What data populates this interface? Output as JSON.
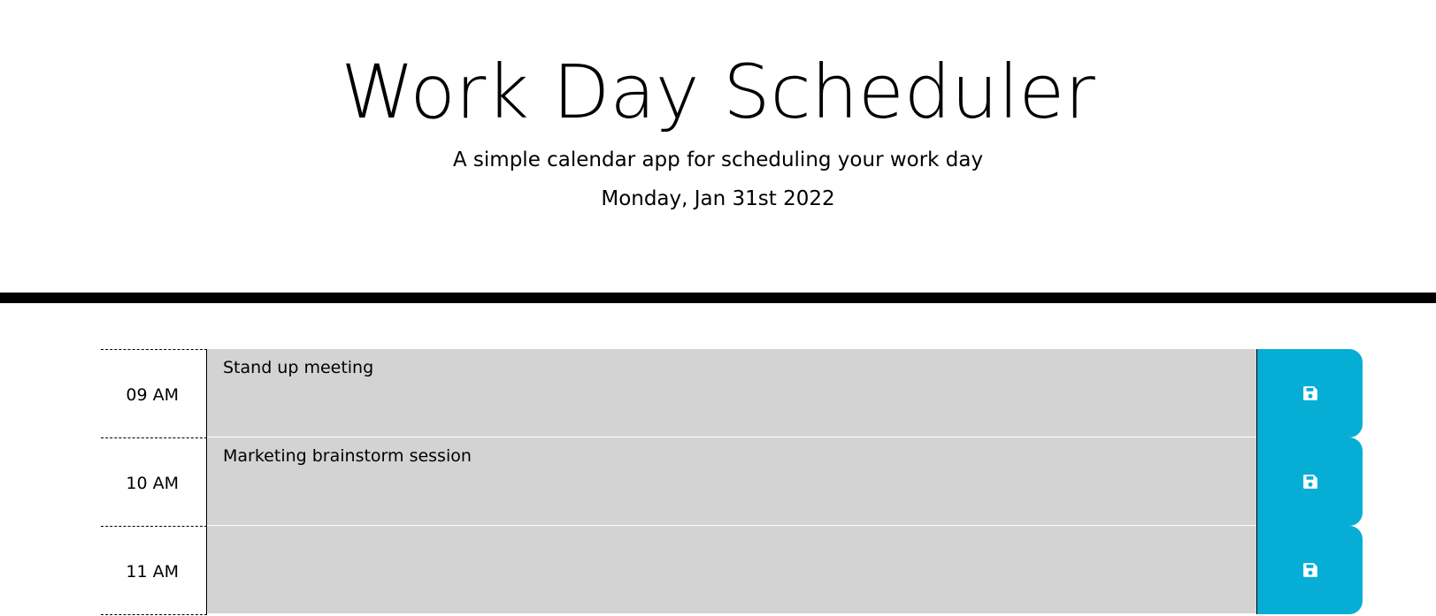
{
  "header": {
    "title": "Work Day Scheduler",
    "subtitle": "A simple calendar app for scheduling your work day",
    "current_day": "Monday, Jan 31st 2022"
  },
  "time_blocks": [
    {
      "hour": "09 AM",
      "description": "Stand up meeting",
      "save_icon": "save-icon"
    },
    {
      "hour": "10 AM",
      "description": "Marketing brainstorm session",
      "save_icon": "save-icon"
    },
    {
      "hour": "11 AM",
      "description": "",
      "save_icon": "save-icon"
    }
  ],
  "colors": {
    "past_block": "#d3d3d3",
    "save_button": "#06aed5",
    "header_border": "#000000"
  }
}
